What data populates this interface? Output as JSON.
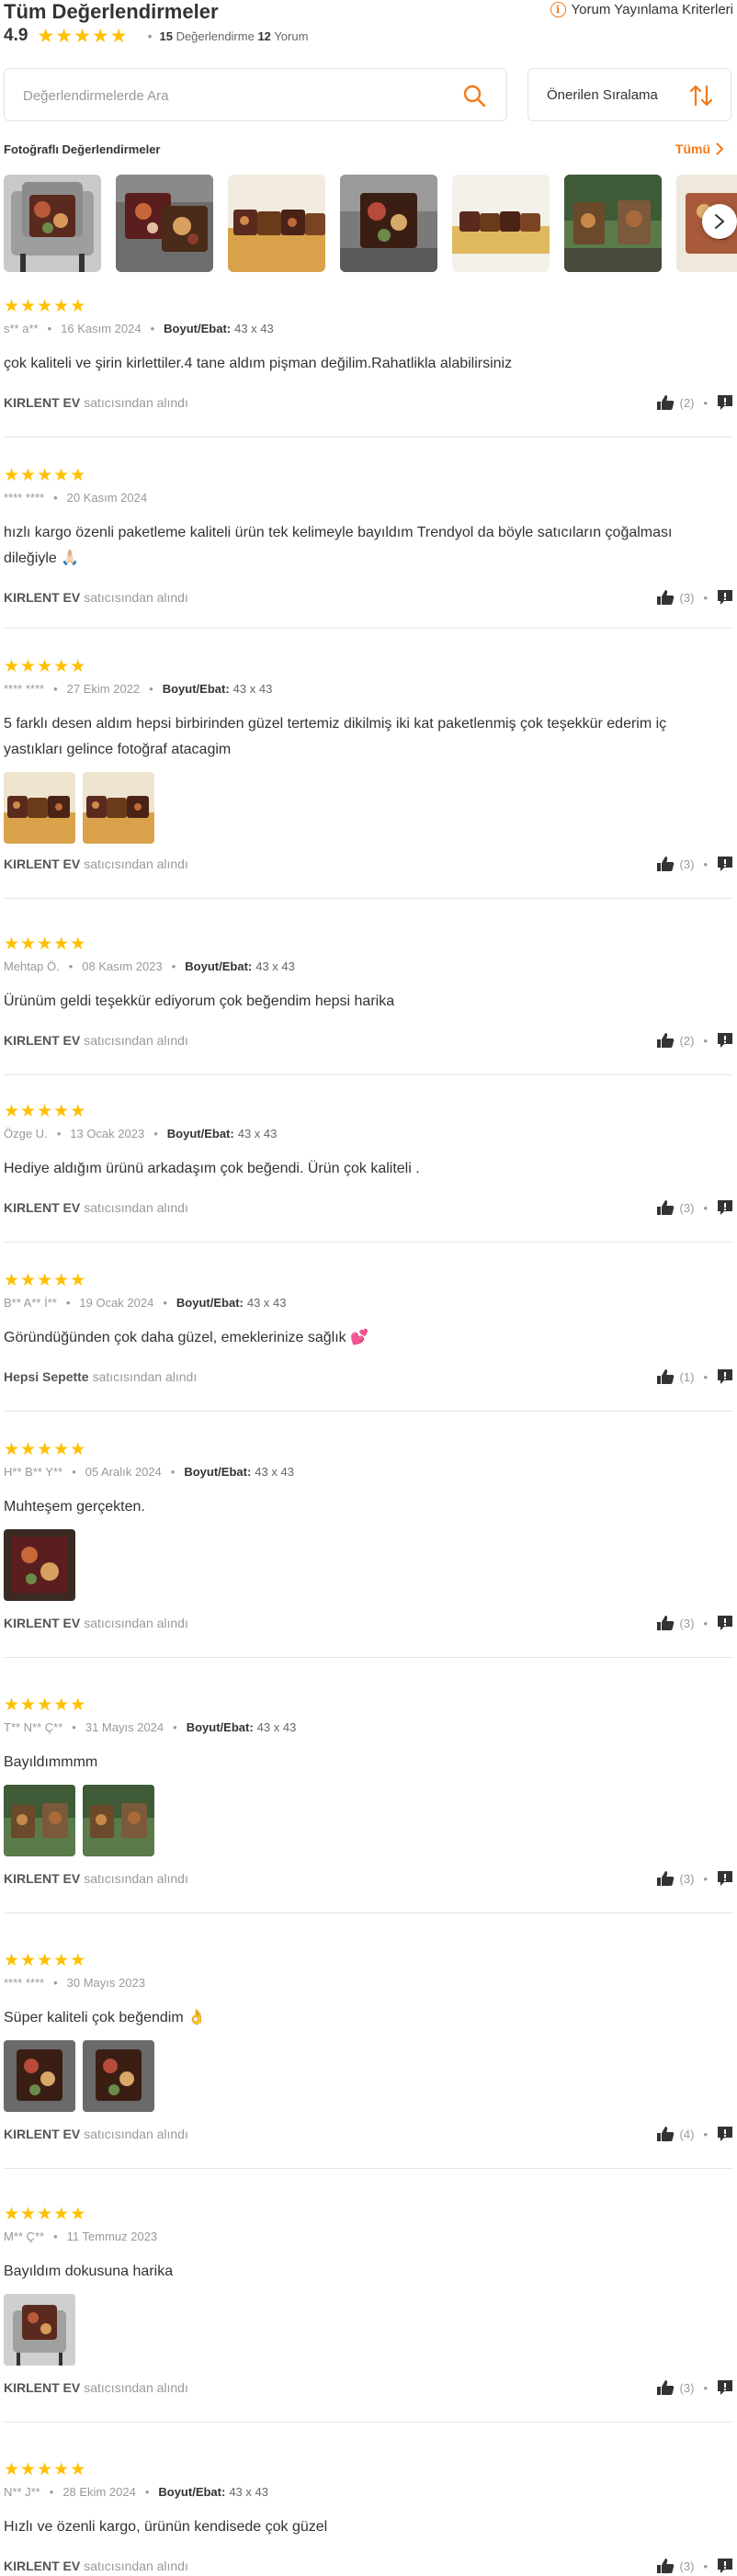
{
  "header": {
    "title": "Tüm Değerlendirmeler",
    "criteria_label": "Yorum Yayınlama Kriterleri",
    "rating": "4.9",
    "review_count": "15",
    "review_count_label": "Değerlendirme",
    "comment_count": "12",
    "comment_count_label": "Yorum"
  },
  "search": {
    "placeholder": "Değerlendirmelerde Ara"
  },
  "sort": {
    "label": "Önerilen Sıralama"
  },
  "photo_reviews": {
    "title": "Fotoğraflı Değerlendirmeler",
    "all_label": "Tümü"
  },
  "colors": {
    "accent": "#f27a1a",
    "star": "#ffc000"
  },
  "size_key": "Boyut/Ebat:",
  "seller_suffix": "satıcısından alındı",
  "reviews": [
    {
      "stars": 5,
      "user": "s** a**",
      "date": "16 Kasım 2024",
      "size": "43 x 43",
      "comment": "çok kaliteli ve şirin kirlettiler.4 tane aldım pişman değilim.Rahatlikla alabilirsiniz",
      "seller": "KIRLENT EV",
      "likes": "(2)",
      "photos": 0
    },
    {
      "stars": 5,
      "user": "**** ****",
      "date": "20 Kasım 2024",
      "size": "",
      "comment": "hızlı kargo özenli paketleme kaliteli ürün tek kelimeyle bayıldım Trendyol da böyle satıcıların çoğalması dileğiyle 🙏🏻",
      "seller": "KIRLENT EV",
      "likes": "(3)",
      "photos": 0
    },
    {
      "stars": 5,
      "user": "**** ****",
      "date": "27 Ekim 2022",
      "size": "43 x 43",
      "comment": "5 farklı desen aldım hepsi birbirinden güzel tertemiz dikilmiş iki kat paketlenmiş çok teşekkür ederim iç yastıkları gelince fotoğraf atacagim",
      "seller": "KIRLENT EV",
      "likes": "(3)",
      "photos": 2
    },
    {
      "stars": 5,
      "user": "Mehtap Ö.",
      "date": "08 Kasım 2023",
      "size": "43 x 43",
      "comment": "Ürünüm geldi teşekkür ediyorum çok beğendim hepsi harika",
      "seller": "KIRLENT EV",
      "likes": "(2)",
      "photos": 0
    },
    {
      "stars": 5,
      "user": "Özge U.",
      "date": "13 Ocak 2023",
      "size": "43 x 43",
      "comment": "Hediye aldığım ürünü arkadaşım çok beğendi. Ürün çok kaliteli .",
      "seller": "KIRLENT EV",
      "likes": "(3)",
      "photos": 0
    },
    {
      "stars": 5,
      "user": "B** A** İ**",
      "date": "19 Ocak 2024",
      "size": "43 x 43",
      "comment": "Göründüğünden çok daha güzel, emeklerinize sağlık 💕",
      "seller": "Hepsi Sepette",
      "likes": "(1)",
      "photos": 0
    },
    {
      "stars": 5,
      "user": "H** B** Y**",
      "date": "05 Aralık 2024",
      "size": "43 x 43",
      "comment": "Muhteşem gerçekten.",
      "seller": "KIRLENT EV",
      "likes": "(3)",
      "photos": 1
    },
    {
      "stars": 5,
      "user": "T** N** Ç**",
      "date": "31 Mayıs 2024",
      "size": "43 x 43",
      "comment": "Bayıldımmmm",
      "seller": "KIRLENT EV",
      "likes": "(3)",
      "photos": 2
    },
    {
      "stars": 5,
      "user": "**** ****",
      "date": "30 Mayıs 2023",
      "size": "",
      "comment": "Süper kaliteli çok beğendim 👌",
      "seller": "KIRLENT EV",
      "likes": "(4)",
      "photos": 2
    },
    {
      "stars": 5,
      "user": "M** Ç**",
      "date": "11 Temmuz 2023",
      "size": "",
      "comment": "Bayıldım dokusuna harika",
      "seller": "KIRLENT EV",
      "likes": "(3)",
      "photos": 1
    },
    {
      "stars": 5,
      "user": "N** J**",
      "date": "28 Ekim 2024",
      "size": "43 x 43",
      "comment": "Hızlı ve özenli kargo, ürünün kendisede çok güzel",
      "seller": "KIRLENT EV",
      "likes": "(3)",
      "photos": 0
    }
  ]
}
